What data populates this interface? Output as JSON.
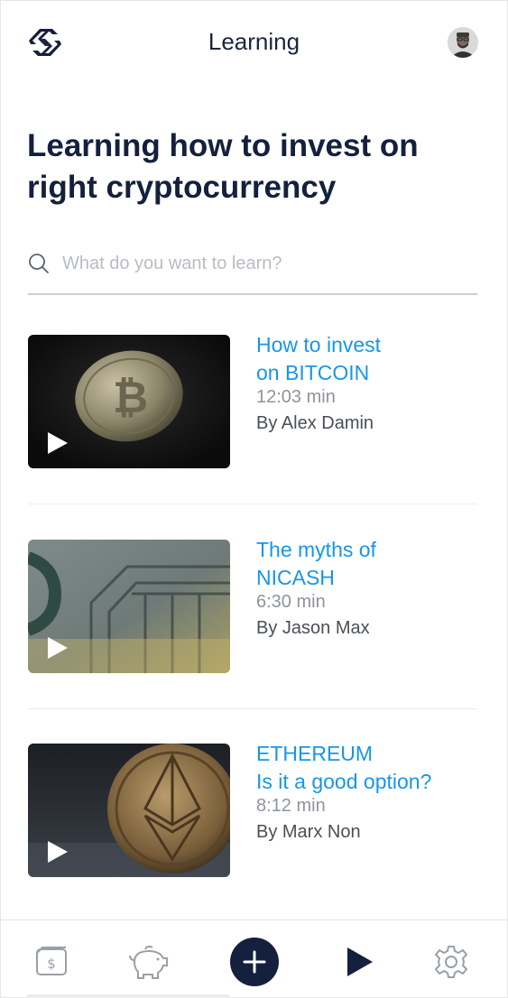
{
  "header": {
    "title": "Learning",
    "logo_icon": "chain-link-logo-icon",
    "avatar_icon": "user-avatar"
  },
  "page_title": "Learning how to invest on right cryptocurrency",
  "search": {
    "placeholder": "What do you want to learn?",
    "value": "",
    "icon": "search-icon"
  },
  "courses": [
    {
      "title_lines": [
        "How to invest",
        "on BITCOIN"
      ],
      "duration": "12:03 min",
      "author": "By Alex Damin",
      "thumb": "bitcoin-coin-image"
    },
    {
      "title_lines": [
        "The myths of",
        "NICASH"
      ],
      "duration": "6:30 min",
      "author": "By Jason Max",
      "thumb": "banknote-image"
    },
    {
      "title_lines": [
        "ETHEREUM",
        "Is it a good option?"
      ],
      "duration": "8:12 min",
      "author": "By Marx Non",
      "thumb": "ethereum-coin-image"
    }
  ],
  "bottom_nav": [
    {
      "icon": "wallet-icon"
    },
    {
      "icon": "piggy-bank-icon"
    },
    {
      "icon": "add-icon"
    },
    {
      "icon": "play-icon"
    },
    {
      "icon": "settings-icon"
    }
  ],
  "colors": {
    "accent": "#1796e8",
    "navy": "#14203d",
    "muted": "#8e949c"
  }
}
